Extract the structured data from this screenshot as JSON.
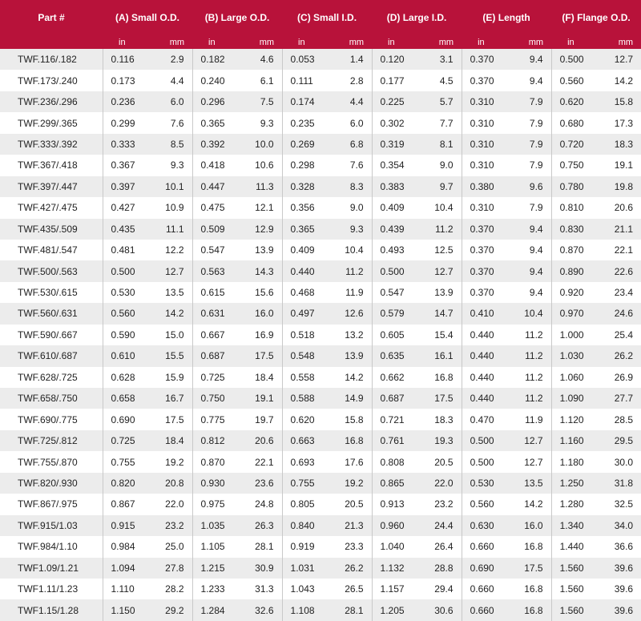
{
  "header": {
    "part": "Part #",
    "groups": [
      "(A) Small O.D.",
      "(B) Large O.D.",
      "(C) Small I.D.",
      "(D) Large I.D.",
      "(E) Length",
      "(F) Flange O.D."
    ],
    "unit_in": "in",
    "unit_mm": "mm"
  },
  "colors": {
    "header_bg": "#b8123a",
    "stripe": "#ececec"
  },
  "rows": [
    [
      "TWF.116/.182",
      "0.116",
      "2.9",
      "0.182",
      "4.6",
      "0.053",
      "1.4",
      "0.120",
      "3.1",
      "0.370",
      "9.4",
      "0.500",
      "12.7"
    ],
    [
      "TWF.173/.240",
      "0.173",
      "4.4",
      "0.240",
      "6.1",
      "0.111",
      "2.8",
      "0.177",
      "4.5",
      "0.370",
      "9.4",
      "0.560",
      "14.2"
    ],
    [
      "TWF.236/.296",
      "0.236",
      "6.0",
      "0.296",
      "7.5",
      "0.174",
      "4.4",
      "0.225",
      "5.7",
      "0.310",
      "7.9",
      "0.620",
      "15.8"
    ],
    [
      "TWF.299/.365",
      "0.299",
      "7.6",
      "0.365",
      "9.3",
      "0.235",
      "6.0",
      "0.302",
      "7.7",
      "0.310",
      "7.9",
      "0.680",
      "17.3"
    ],
    [
      "TWF.333/.392",
      "0.333",
      "8.5",
      "0.392",
      "10.0",
      "0.269",
      "6.8",
      "0.319",
      "8.1",
      "0.310",
      "7.9",
      "0.720",
      "18.3"
    ],
    [
      "TWF.367/.418",
      "0.367",
      "9.3",
      "0.418",
      "10.6",
      "0.298",
      "7.6",
      "0.354",
      "9.0",
      "0.310",
      "7.9",
      "0.750",
      "19.1"
    ],
    [
      "TWF.397/.447",
      "0.397",
      "10.1",
      "0.447",
      "11.3",
      "0.328",
      "8.3",
      "0.383",
      "9.7",
      "0.380",
      "9.6",
      "0.780",
      "19.8"
    ],
    [
      "TWF.427/.475",
      "0.427",
      "10.9",
      "0.475",
      "12.1",
      "0.356",
      "9.0",
      "0.409",
      "10.4",
      "0.310",
      "7.9",
      "0.810",
      "20.6"
    ],
    [
      "TWF.435/.509",
      "0.435",
      "11.1",
      "0.509",
      "12.9",
      "0.365",
      "9.3",
      "0.439",
      "11.2",
      "0.370",
      "9.4",
      "0.830",
      "21.1"
    ],
    [
      "TWF.481/.547",
      "0.481",
      "12.2",
      "0.547",
      "13.9",
      "0.409",
      "10.4",
      "0.493",
      "12.5",
      "0.370",
      "9.4",
      "0.870",
      "22.1"
    ],
    [
      "TWF.500/.563",
      "0.500",
      "12.7",
      "0.563",
      "14.3",
      "0.440",
      "11.2",
      "0.500",
      "12.7",
      "0.370",
      "9.4",
      "0.890",
      "22.6"
    ],
    [
      "TWF.530/.615",
      "0.530",
      "13.5",
      "0.615",
      "15.6",
      "0.468",
      "11.9",
      "0.547",
      "13.9",
      "0.370",
      "9.4",
      "0.920",
      "23.4"
    ],
    [
      "TWF.560/.631",
      "0.560",
      "14.2",
      "0.631",
      "16.0",
      "0.497",
      "12.6",
      "0.579",
      "14.7",
      "0.410",
      "10.4",
      "0.970",
      "24.6"
    ],
    [
      "TWF.590/.667",
      "0.590",
      "15.0",
      "0.667",
      "16.9",
      "0.518",
      "13.2",
      "0.605",
      "15.4",
      "0.440",
      "11.2",
      "1.000",
      "25.4"
    ],
    [
      "TWF.610/.687",
      "0.610",
      "15.5",
      "0.687",
      "17.5",
      "0.548",
      "13.9",
      "0.635",
      "16.1",
      "0.440",
      "11.2",
      "1.030",
      "26.2"
    ],
    [
      "TWF.628/.725",
      "0.628",
      "15.9",
      "0.725",
      "18.4",
      "0.558",
      "14.2",
      "0.662",
      "16.8",
      "0.440",
      "11.2",
      "1.060",
      "26.9"
    ],
    [
      "TWF.658/.750",
      "0.658",
      "16.7",
      "0.750",
      "19.1",
      "0.588",
      "14.9",
      "0.687",
      "17.5",
      "0.440",
      "11.2",
      "1.090",
      "27.7"
    ],
    [
      "TWF.690/.775",
      "0.690",
      "17.5",
      "0.775",
      "19.7",
      "0.620",
      "15.8",
      "0.721",
      "18.3",
      "0.470",
      "11.9",
      "1.120",
      "28.5"
    ],
    [
      "TWF.725/.812",
      "0.725",
      "18.4",
      "0.812",
      "20.6",
      "0.663",
      "16.8",
      "0.761",
      "19.3",
      "0.500",
      "12.7",
      "1.160",
      "29.5"
    ],
    [
      "TWF.755/.870",
      "0.755",
      "19.2",
      "0.870",
      "22.1",
      "0.693",
      "17.6",
      "0.808",
      "20.5",
      "0.500",
      "12.7",
      "1.180",
      "30.0"
    ],
    [
      "TWF.820/.930",
      "0.820",
      "20.8",
      "0.930",
      "23.6",
      "0.755",
      "19.2",
      "0.865",
      "22.0",
      "0.530",
      "13.5",
      "1.250",
      "31.8"
    ],
    [
      "TWF.867/.975",
      "0.867",
      "22.0",
      "0.975",
      "24.8",
      "0.805",
      "20.5",
      "0.913",
      "23.2",
      "0.560",
      "14.2",
      "1.280",
      "32.5"
    ],
    [
      "TWF.915/1.03",
      "0.915",
      "23.2",
      "1.035",
      "26.3",
      "0.840",
      "21.3",
      "0.960",
      "24.4",
      "0.630",
      "16.0",
      "1.340",
      "34.0"
    ],
    [
      "TWF.984/1.10",
      "0.984",
      "25.0",
      "1.105",
      "28.1",
      "0.919",
      "23.3",
      "1.040",
      "26.4",
      "0.660",
      "16.8",
      "1.440",
      "36.6"
    ],
    [
      "TWF1.09/1.21",
      "1.094",
      "27.8",
      "1.215",
      "30.9",
      "1.031",
      "26.2",
      "1.132",
      "28.8",
      "0.690",
      "17.5",
      "1.560",
      "39.6"
    ],
    [
      "TWF1.11/1.23",
      "1.110",
      "28.2",
      "1.233",
      "31.3",
      "1.043",
      "26.5",
      "1.157",
      "29.4",
      "0.660",
      "16.8",
      "1.560",
      "39.6"
    ],
    [
      "TWF1.15/1.28",
      "1.150",
      "29.2",
      "1.284",
      "32.6",
      "1.108",
      "28.1",
      "1.205",
      "30.6",
      "0.660",
      "16.8",
      "1.560",
      "39.6"
    ]
  ]
}
